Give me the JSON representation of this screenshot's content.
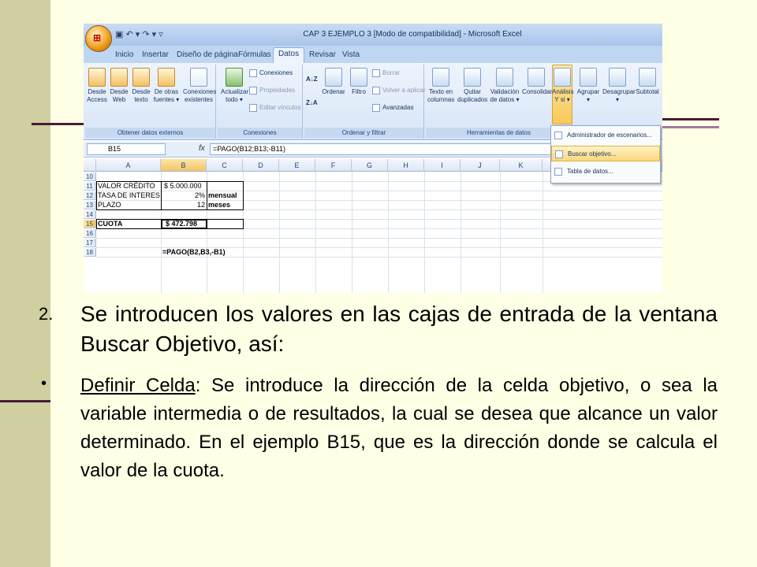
{
  "excel": {
    "window_title": "CAP 3 EJEMPLO 3  [Modo de compatibilidad] - Microsoft Excel",
    "office_button_label": "",
    "tabs": [
      "Inicio",
      "Insertar",
      "Diseño de página",
      "Fórmulas",
      "Datos",
      "Revisar",
      "Vista"
    ],
    "active_tab": "Datos",
    "groups": {
      "external": {
        "label": "Obtener datos externos",
        "buttons": [
          "Desde Access",
          "Desde Web",
          "Desde texto",
          "De otras fuentes ▾",
          "Conexiones existentes"
        ]
      },
      "connections": {
        "label": "Conexiones",
        "refresh": "Actualizar todo ▾",
        "items": [
          "Conexiones",
          "Propiedades",
          "Editar vínculos"
        ]
      },
      "sort": {
        "label": "Ordenar y filtrar",
        "sort_az": "A↓Z",
        "sort_za": "Z↓A",
        "order": "Ordenar",
        "filter": "Filtro",
        "items": [
          "Borrar",
          "Volver a aplicar",
          "Avanzadas"
        ]
      },
      "tools": {
        "label": "Herramientas de datos",
        "buttons": [
          "Texto en columnas",
          "Quitar duplicados",
          "Validación de datos ▾",
          "Consolidar",
          "Análisis Y si ▾"
        ]
      },
      "outline": {
        "buttons": [
          "Agrupar ▾",
          "Desagrupar ▾",
          "Subtotal"
        ]
      }
    },
    "formula_bar": {
      "name_box": "B15",
      "fx": "fx",
      "formula": "=PAGO(B12;B13;-B11)"
    },
    "columns": [
      "A",
      "B",
      "C",
      "D",
      "E",
      "F",
      "G",
      "H",
      "I",
      "J",
      "K"
    ],
    "rows": [
      "10",
      "11",
      "12",
      "13",
      "14",
      "15",
      "16",
      "17",
      "18"
    ],
    "cells": {
      "a11": "VALOR CRÉDITO",
      "b11": "$ 5.000.000",
      "a12": "TASA DE INTERES",
      "b12": "2%",
      "c12": "mensual",
      "a13": "PLAZO",
      "b13": "12",
      "c13": "meses",
      "a15": "CUOTA",
      "b15": "$ 472.798",
      "b17": "=PAGO(B2,B3,-B1)"
    },
    "menu": {
      "items": [
        "Administrador de escenarios...",
        "Buscar objetivo...",
        "Tabla de datos..."
      ],
      "active_index": 1
    }
  },
  "slide": {
    "step_number": "2.",
    "step_text": "Se introducen los valores en las cajas de entrada de la ventana Buscar Objetivo, así:",
    "bullet_symbol": "•",
    "bullet_term": "Definir Celda",
    "bullet_text": ": Se introduce la dirección de la celda objetivo, o sea la variable intermedia o de resultados, la cual se desea que alcance un valor determinado.  En el ejemplo B15, que es la dirección donde se calcula el valor de la cuota."
  }
}
